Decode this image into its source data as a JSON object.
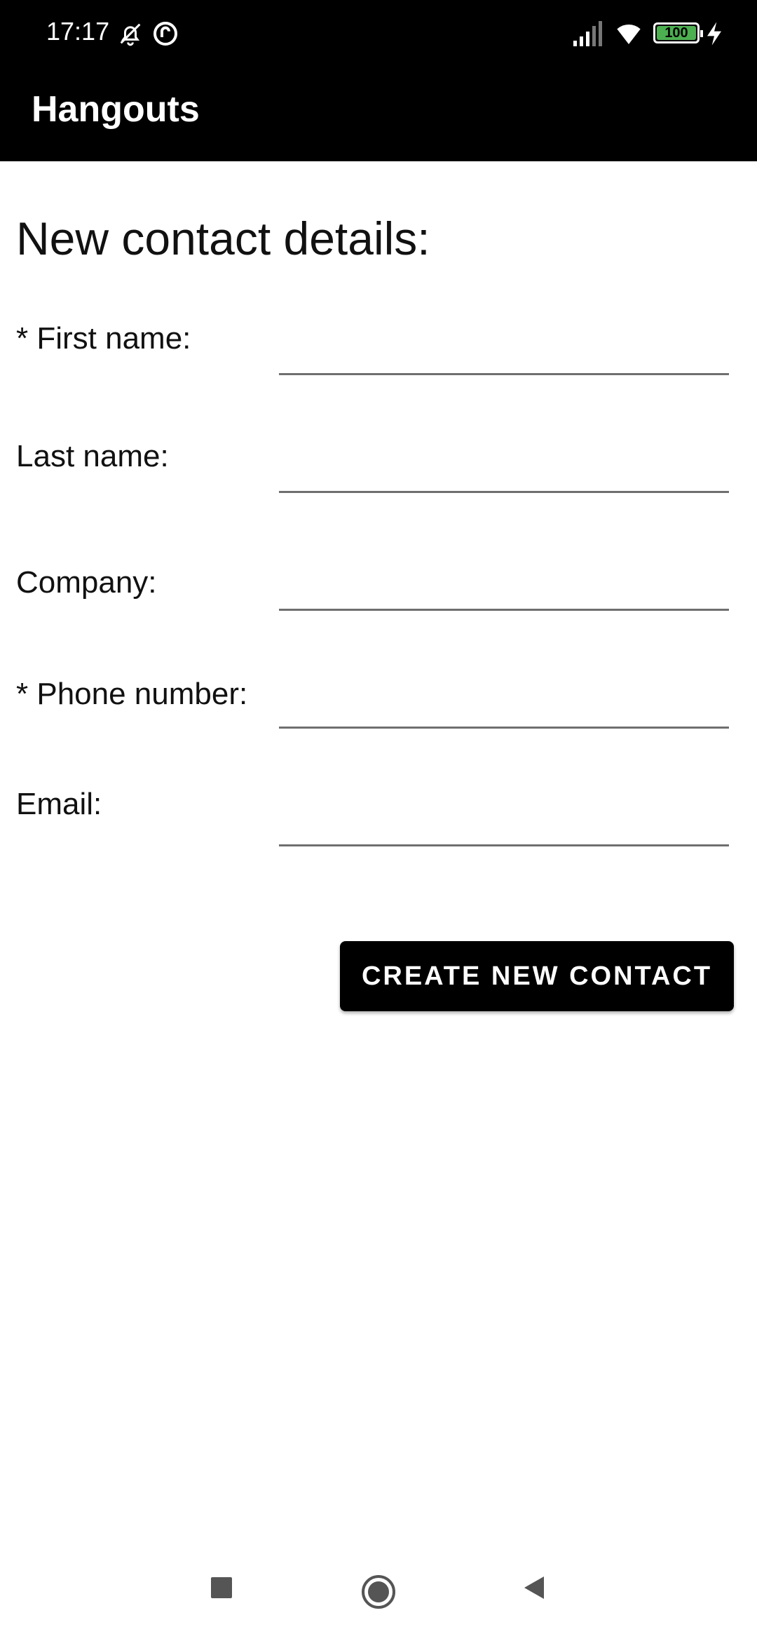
{
  "status_bar": {
    "time": "17:17",
    "battery": "100",
    "icons": [
      "notifications-off-icon",
      "data-saver-icon",
      "signal-icon",
      "wifi-icon",
      "battery-icon",
      "charging-icon"
    ]
  },
  "app_bar": {
    "title": "Hangouts"
  },
  "form": {
    "heading": "New contact details:",
    "fields": [
      {
        "label": "* First name:",
        "value": ""
      },
      {
        "label": "Last name:",
        "value": ""
      },
      {
        "label": "Company:",
        "value": ""
      },
      {
        "label": "* Phone number:",
        "value": ""
      },
      {
        "label": "Email:",
        "value": ""
      }
    ],
    "submit_label": "CREATE NEW CONTACT"
  },
  "nav_bar": {
    "icons": [
      "recents-icon",
      "home-icon",
      "back-icon"
    ]
  },
  "colors": {
    "bar_background": "#000000",
    "page_background": "#ffffff",
    "battery_fill": "#4caf50"
  }
}
